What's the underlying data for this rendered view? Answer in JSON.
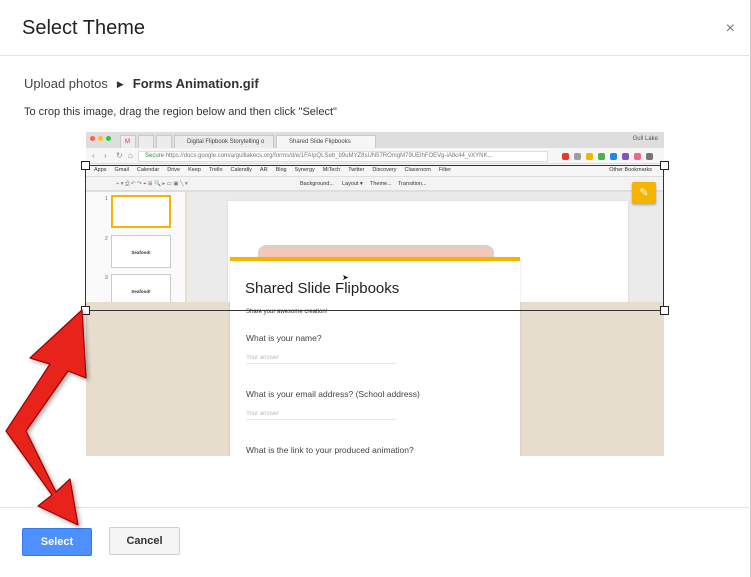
{
  "dialog": {
    "title": "Select Theme",
    "close_label": "×"
  },
  "breadcrumb": {
    "parent": "Upload photos",
    "separator": "▶",
    "current": "Forms Animation.gif"
  },
  "instructions": "To crop this image, drag the region below and then click \"Select\"",
  "screenshot": {
    "tabs": [
      "Digital Flipbook Storytelling o",
      "Shared Slide Flipbooks"
    ],
    "user": "Gull Lake",
    "secure_label": "Secure",
    "url": "https://docs.google.com/a/gulllakecs.org/forms/d/e/1FAIpQLSeb_b9uMYZ8sUN57ROmgM79UElhFOEVg-iA8c44_vXYNK...",
    "bookmarks": [
      "Apps",
      "Gmail",
      "Calendar",
      "Drive",
      "Keep",
      "Trello",
      "Calendly",
      "AR",
      "Blog",
      "Synergy",
      "MiTech",
      "Twitter",
      "Discovery",
      "Classroom",
      "Filter"
    ],
    "other_bookmarks": "Other Bookmarks",
    "toolbar": [
      "Background...",
      "Layout ▾",
      "Theme...",
      "Transition..."
    ],
    "slide_numbers": [
      "1",
      "2",
      "3"
    ],
    "thumb_titles": [
      "",
      "Seafood!",
      "Seafood!"
    ],
    "form": {
      "title": "Shared Slide Flipbooks",
      "subtitle": "Share your awesome creation!",
      "questions": [
        "What is your name?",
        "What is your email address? (School address)",
        "What is the link to your produced animation?"
      ],
      "answer_placeholder": "Your answer"
    }
  },
  "buttons": {
    "select": "Select",
    "cancel": "Cancel"
  },
  "colors": {
    "primary": "#4d90fe",
    "accent": "#f4b400",
    "arrow": "#e8231b"
  }
}
